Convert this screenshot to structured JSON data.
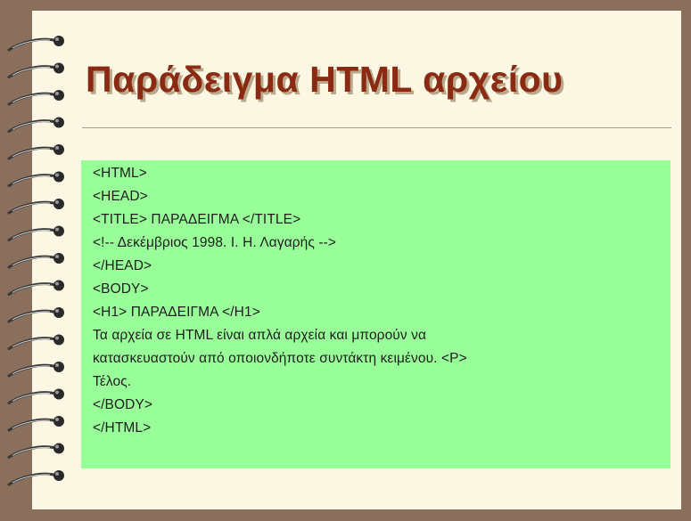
{
  "slide": {
    "title": "Παράδειγμα HTML αρχείου",
    "code_lines": [
      "<HTML>",
      "<HEAD>",
      "<TITLE> ΠΑΡΑΔΕΙΓΜΑ </TITLE>",
      "<!-- Δεκέμβριος 1998. Ι. Η. Λαγαρής  -->",
      "</HEAD>",
      "<BODY>",
      "<H1> ΠΑΡΑΔΕΙΓΜΑ </H1>",
      "Τα αρχεία σε HTML είναι απλά αρχεία και μπορούν να",
      "κατασκευαστούν από οποιονδήποτε συντάκτη κειμένου.  <P>",
      "Τέλος.",
      "</BODY>",
      "</HTML>"
    ]
  },
  "colors": {
    "frame": "#8a6f5c",
    "paper": "#fbf7e3",
    "title": "#8b2a12",
    "code_background": "#99ff99"
  }
}
